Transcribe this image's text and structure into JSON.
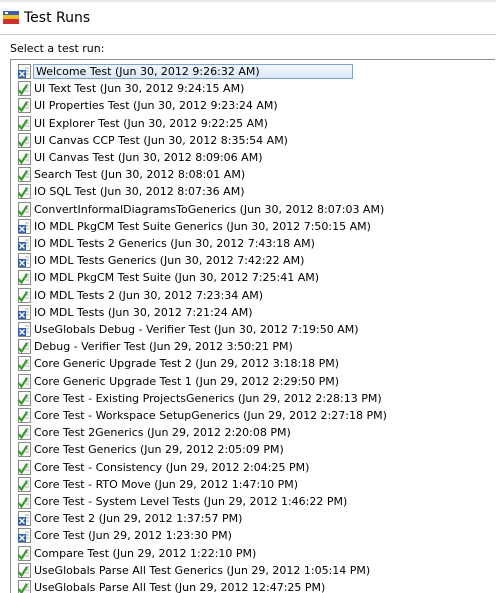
{
  "window": {
    "title": "Test Runs",
    "icon": "test-runs-app-icon"
  },
  "prompt": "Select a test run:",
  "colors": {
    "check_green": "#3a9a32",
    "error_blue": "#2f5fa8",
    "selection_border": "#7da2ce"
  },
  "test_runs": [
    {
      "label": "Welcome Test (Jun 30, 2012 9:26:32 AM)",
      "status": "error",
      "selected": true
    },
    {
      "label": "UI Text Test (Jun 30, 2012 9:24:15 AM)",
      "status": "passed"
    },
    {
      "label": "UI Properties Test (Jun 30, 2012 9:23:24 AM)",
      "status": "passed"
    },
    {
      "label": "UI Explorer Test (Jun 30, 2012 9:22:25 AM)",
      "status": "passed"
    },
    {
      "label": "UI Canvas CCP Test (Jun 30, 2012 8:35:54 AM)",
      "status": "passed"
    },
    {
      "label": "UI Canvas Test (Jun 30, 2012 8:09:06 AM)",
      "status": "passed"
    },
    {
      "label": "Search Test (Jun 30, 2012 8:08:01 AM)",
      "status": "passed"
    },
    {
      "label": "IO SQL Test (Jun 30, 2012 8:07:36 AM)",
      "status": "passed"
    },
    {
      "label": "ConvertInformalDiagramsToGenerics (Jun 30, 2012 8:07:03 AM)",
      "status": "passed"
    },
    {
      "label": "IO MDL PkgCM Test Suite Generics (Jun 30, 2012 7:50:15 AM)",
      "status": "error"
    },
    {
      "label": "IO MDL Tests 2 Generics (Jun 30, 2012 7:43:18 AM)",
      "status": "error"
    },
    {
      "label": "IO MDL Tests Generics (Jun 30, 2012 7:42:22 AM)",
      "status": "error"
    },
    {
      "label": "IO MDL PkgCM Test Suite (Jun 30, 2012 7:25:41 AM)",
      "status": "passed"
    },
    {
      "label": "IO MDL Tests 2 (Jun 30, 2012 7:23:34 AM)",
      "status": "passed"
    },
    {
      "label": "IO MDL Tests (Jun 30, 2012 7:21:24 AM)",
      "status": "error"
    },
    {
      "label": "UseGlobals Debug - Verifier Test (Jun 30, 2012 7:19:50 AM)",
      "status": "error"
    },
    {
      "label": "Debug - Verifier Test (Jun 29, 2012 3:50:21 PM)",
      "status": "passed"
    },
    {
      "label": "Core Generic Upgrade Test 2 (Jun 29, 2012 3:18:18 PM)",
      "status": "passed"
    },
    {
      "label": "Core Generic Upgrade Test 1 (Jun 29, 2012 2:29:50 PM)",
      "status": "passed"
    },
    {
      "label": "Core Test - Existing ProjectsGenerics (Jun 29, 2012 2:28:13 PM)",
      "status": "passed"
    },
    {
      "label": "Core Test - Workspace SetupGenerics (Jun 29, 2012 2:27:18 PM)",
      "status": "passed"
    },
    {
      "label": "Core Test 2Generics (Jun 29, 2012 2:20:08 PM)",
      "status": "passed"
    },
    {
      "label": "Core Test Generics (Jun 29, 2012 2:05:09 PM)",
      "status": "passed"
    },
    {
      "label": "Core Test - Consistency (Jun 29, 2012 2:04:25 PM)",
      "status": "passed"
    },
    {
      "label": "Core Test - RTO Move (Jun 29, 2012 1:47:10 PM)",
      "status": "passed"
    },
    {
      "label": "Core Test - System Level Tests (Jun 29, 2012 1:46:22 PM)",
      "status": "passed"
    },
    {
      "label": "Core Test 2 (Jun 29, 2012 1:37:57 PM)",
      "status": "error"
    },
    {
      "label": "Core Test (Jun 29, 2012 1:23:30 PM)",
      "status": "error"
    },
    {
      "label": "Compare Test (Jun 29, 2012 1:22:10 PM)",
      "status": "passed"
    },
    {
      "label": "UseGlobals Parse All Test Generics (Jun 29, 2012 1:05:14 PM)",
      "status": "passed"
    },
    {
      "label": "UseGlobals Parse All Test (Jun 29, 2012 12:47:25 PM)",
      "status": "passed"
    },
    {
      "label": "",
      "status": "passed"
    }
  ]
}
